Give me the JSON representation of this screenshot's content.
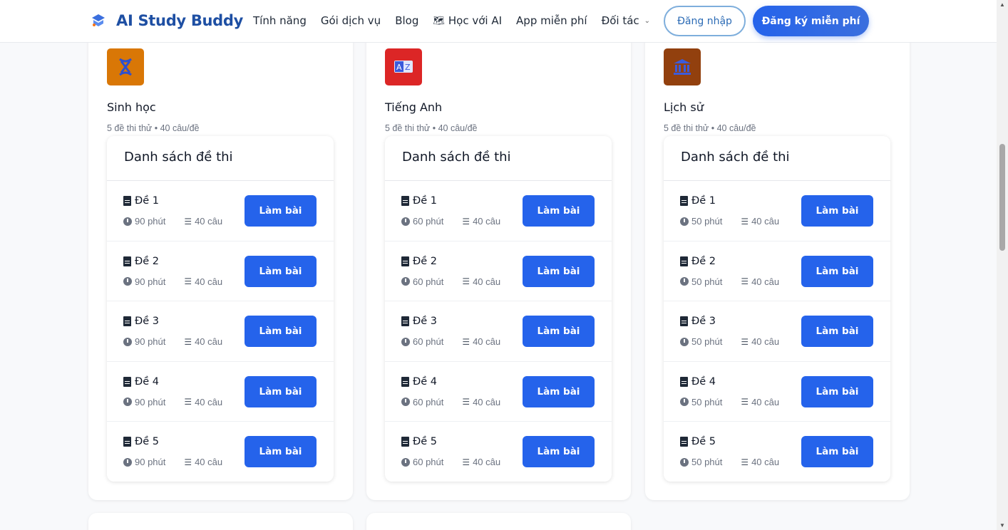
{
  "header": {
    "brand": "AI Study Buddy",
    "nav": [
      {
        "label": "Tính năng",
        "icon": ""
      },
      {
        "label": "Gói dịch vụ",
        "icon": ""
      },
      {
        "label": "Blog",
        "icon": ""
      },
      {
        "label": "Học với AI",
        "icon": "map-icon"
      },
      {
        "label": "App miễn phí",
        "icon": ""
      },
      {
        "label": "Đối tác",
        "icon": "chevron-down-icon"
      }
    ],
    "login_label": "Đăng nhập",
    "signup_label": "Đăng ký miễn phí"
  },
  "list_title": "Danh sách đề thi",
  "do_label": "Làm bài",
  "subjects": [
    {
      "name": "Sinh học",
      "meta": "5 đề thi thử • 40 câu/đề",
      "icon": "dna-icon",
      "icon_color": "#d97706",
      "exams": [
        {
          "name": "Đề 1",
          "duration": "90 phút",
          "questions": "40 câu"
        },
        {
          "name": "Đề 2",
          "duration": "90 phút",
          "questions": "40 câu"
        },
        {
          "name": "Đề 3",
          "duration": "90 phút",
          "questions": "40 câu"
        },
        {
          "name": "Đề 4",
          "duration": "90 phút",
          "questions": "40 câu"
        },
        {
          "name": "Đề 5",
          "duration": "90 phút",
          "questions": "40 câu"
        }
      ]
    },
    {
      "name": "Tiếng Anh",
      "meta": "5 đề thi thử • 40 câu/đề",
      "icon": "translate-icon",
      "icon_color": "#dc2626",
      "exams": [
        {
          "name": "Đề 1",
          "duration": "60 phút",
          "questions": "40 câu"
        },
        {
          "name": "Đề 2",
          "duration": "60 phút",
          "questions": "40 câu"
        },
        {
          "name": "Đề 3",
          "duration": "60 phút",
          "questions": "40 câu"
        },
        {
          "name": "Đề 4",
          "duration": "60 phút",
          "questions": "40 câu"
        },
        {
          "name": "Đề 5",
          "duration": "60 phút",
          "questions": "40 câu"
        }
      ]
    },
    {
      "name": "Lịch sử",
      "meta": "5 đề thi thử • 40 câu/đề",
      "icon": "museum-icon",
      "icon_color": "#92400e",
      "exams": [
        {
          "name": "Đề 1",
          "duration": "50 phút",
          "questions": "40 câu"
        },
        {
          "name": "Đề 2",
          "duration": "50 phút",
          "questions": "40 câu"
        },
        {
          "name": "Đề 3",
          "duration": "50 phút",
          "questions": "40 câu"
        },
        {
          "name": "Đề 4",
          "duration": "50 phút",
          "questions": "40 câu"
        },
        {
          "name": "Đề 5",
          "duration": "50 phút",
          "questions": "40 câu"
        }
      ]
    }
  ],
  "colors": {
    "primary": "#2563eb",
    "brand": "#1e4fa3"
  }
}
